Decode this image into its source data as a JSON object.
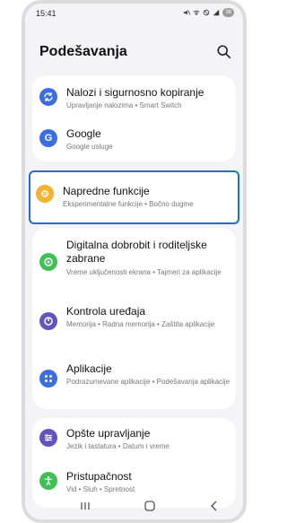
{
  "status": {
    "time": "15:41",
    "battery": "38"
  },
  "header": {
    "title": "Podešavanja",
    "search_icon": "search-icon"
  },
  "items": [
    {
      "label": "Nalozi i sigurnosno kopiranje",
      "sub": "Upravljanje nalozima • Smart Switch",
      "icon": "sync-icon",
      "color": "#3b6fe0"
    },
    {
      "label": "Google",
      "sub": "Google usluge",
      "icon": "google-icon",
      "color": "#3b6fe0"
    },
    {
      "label": "Napredne funkcije",
      "sub": "Eksperimentalne funkcije • Bočno dugme",
      "icon": "gear-plus-icon",
      "color": "#f2b233"
    },
    {
      "label": "Digitalna dobrobit i roditeljske zabrane",
      "sub": "Vreme uključenosti ekrana • Tajmeri za aplikacije",
      "icon": "wellbeing-icon",
      "color": "#3fbf54"
    },
    {
      "label": "Kontrola uređaja",
      "sub": "Memorija • Radna memorija • Zaštita aplikacije",
      "icon": "device-care-icon",
      "color": "#6554c0"
    },
    {
      "label": "Aplikacije",
      "sub": "Podrazumevane aplikacije • Podešavanja aplikacije",
      "icon": "apps-icon",
      "color": "#3b6fe0"
    },
    {
      "label": "Opšte upravljanje",
      "sub": "Jezik i tastatura • Datum i vreme",
      "icon": "sliders-icon",
      "color": "#6554c0"
    },
    {
      "label": "Pristupačnost",
      "sub": "Vid • Sluh • Spretnost",
      "icon": "accessibility-icon",
      "color": "#3fbf54"
    }
  ],
  "nav": {
    "recents": "recents-icon",
    "home": "home-icon",
    "back": "back-icon"
  }
}
